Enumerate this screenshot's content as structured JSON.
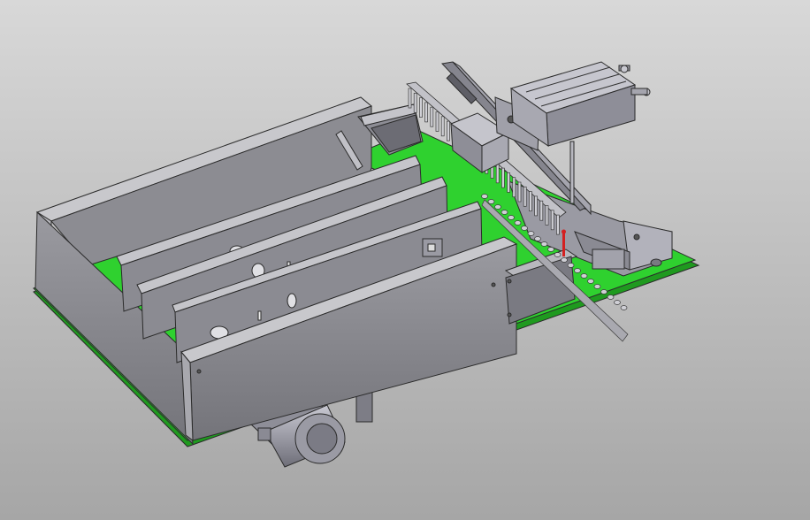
{
  "scene": {
    "background": {
      "top": "#d6d6d6",
      "bottom": "#a9a9a9"
    },
    "colors": {
      "board": "#2fd12f",
      "board_edge": "#1f9a1f",
      "panel_light": "#a7a7ad",
      "panel_mid": "#8c8c92",
      "panel_dark": "#65656b",
      "metal_light": "#b9b9c2",
      "metal_dark": "#7a7a84",
      "edge": "#2b2b2b",
      "pin_red": "#d42020"
    }
  }
}
